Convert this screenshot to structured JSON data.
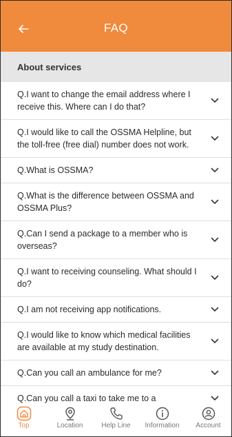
{
  "header": {
    "title": "FAQ",
    "back_icon": "arrow-left-icon"
  },
  "section": {
    "title": "About services"
  },
  "faq_items": [
    "Q.I want to change the email address where I receive this. Where can I do that?",
    "Q.I would like to call the OSSMA Helpline, but the toll-free (free dial) number does not work.",
    "Q.What is OSSMA?",
    "Q.What is the difference between OSSMA and OSSMA Plus?",
    "Q.Can I send a package to a member who is overseas?",
    "Q.I want to receiving counseling. What should I do?",
    "Q.I am not receiving app notifications.",
    "Q.I would like to know which medical facilities are available at my study destination.",
    "Q.Can you call an ambulance for me?",
    "Q.Can you call a taxi to take me to a"
  ],
  "bottom_nav": [
    {
      "label": "Top",
      "icon": "home-icon",
      "active": true
    },
    {
      "label": "Location",
      "icon": "location-pin-icon",
      "active": false
    },
    {
      "label": "Help Line",
      "icon": "phone-icon",
      "active": false
    },
    {
      "label": "Information",
      "icon": "info-icon",
      "active": false
    },
    {
      "label": "Account",
      "icon": "account-icon",
      "active": false
    }
  ],
  "colors": {
    "accent": "#f08a3c",
    "section_bg": "#e6e6e6"
  }
}
